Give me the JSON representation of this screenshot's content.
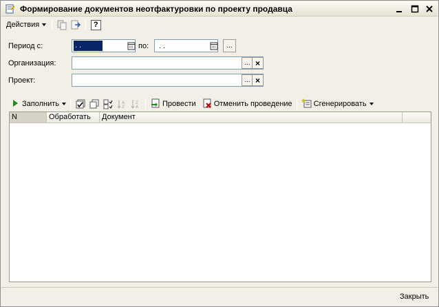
{
  "window": {
    "title": "Формирование документов неотфактуровки по проекту продавца",
    "icon": "document-form-icon",
    "controls": [
      "minimize-icon",
      "maximize-icon",
      "close-icon"
    ]
  },
  "actionbar": {
    "actions_label": "Действия",
    "icons": [
      "copy-icon",
      "navigate-icon",
      "help-icon"
    ],
    "help_glyph": "?"
  },
  "form": {
    "period_from_label": "Период с:",
    "period_from_value": ". .",
    "period_to_label": "по:",
    "period_to_value": ". .",
    "choose_glyph": "...",
    "clear_glyph": "×",
    "organization_label": "Организация:",
    "organization_value": "",
    "project_label": "Проект:",
    "project_value": ""
  },
  "table_toolbar": {
    "fill_label": "Заполнить",
    "post_label": "Провести",
    "unpost_label": "Отменить проведение",
    "generate_label": "Сгенерировать",
    "icons": [
      "play-icon",
      "check-all-icon",
      "copy-rows-icon",
      "select-icon",
      "sort-asc-icon",
      "sort-desc-icon",
      "post-icon",
      "unpost-icon",
      "generate-icon"
    ]
  },
  "table": {
    "columns": [
      "N",
      "Обработать",
      "Документ"
    ],
    "rows": []
  },
  "footer": {
    "close_label": "Закрыть"
  },
  "colors": {
    "selection": "#0a246a",
    "window_bg": "#f1efe6",
    "play_green": "#1e8a1e"
  }
}
